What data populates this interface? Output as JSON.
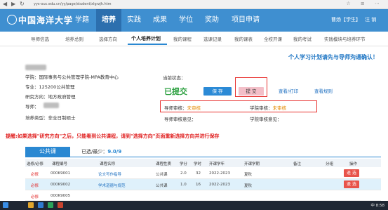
{
  "browser": {
    "url": "yys-ouc.edu.cn/yy/page/student/xlgrzjh.htm",
    "back": "◀",
    "forward": "▶",
    "refresh": "↻",
    "right_icons": "☆ ≡ ⋯"
  },
  "header": {
    "school_name": "中国海洋大学",
    "nav": [
      "学籍",
      "培养",
      "实践",
      "成果",
      "学位",
      "奖助",
      "项目申请"
    ],
    "user_name": "曹炀【学生】",
    "logout": "注 销"
  },
  "subnav": [
    "导师信选",
    "培养总则",
    "选择方向",
    "个人培养计划",
    "我的课程",
    "选课记录",
    "我的课表",
    "全校开课",
    "我的考试",
    "实践模块与培养环节"
  ],
  "panel": {
    "notice": "个人学习计划请先与导师沟通确认！",
    "info": [
      {
        "label": "学院：",
        "value": "国际事务与公共管理学院-MPA教育中心"
      },
      {
        "label": "专业：",
        "value": "125200公共管理"
      },
      {
        "label": "研究方向：",
        "value": "地方政府管理"
      },
      {
        "label": "导师：",
        "value": ""
      },
      {
        "label": "培养类型：",
        "value": "非全日制硕士"
      }
    ],
    "status_label": "当前状态：",
    "status_value": "已提交",
    "save": "保 存",
    "submit": "提 交",
    "view_print": "查看/打印",
    "view_rules": "查看规则",
    "advisor_review_label": "导师审核：",
    "advisor_review_value": "未审核",
    "college_review_label": "学院审核：",
    "college_review_value": "未审核",
    "advisor_opinion_label": "导师审核意见：",
    "college_opinion_label": "学院审核意见：",
    "warning": "提醒:如果选择\"研究方向\"之后，只能看到公共课程，请到\"选择方向\"页面重新选择方向并进行保存"
  },
  "table": {
    "tab": "公共课",
    "credits_label": "已选/最少：",
    "credits_value": "9.0/9",
    "headers": [
      "选修/必修",
      "课程编号",
      "课程名称",
      "课程性质",
      "学分",
      "学时",
      "开课学年",
      "开课学期",
      "备注",
      "分组",
      "操作"
    ],
    "rows": [
      {
        "req": "必修",
        "code": "000K9001",
        "name": "论文写作指导",
        "type": "公共课",
        "credit": "2.0",
        "hours": "32",
        "year": "2022-2023",
        "term": "夏秋",
        "note": "",
        "group": "",
        "action": "退 选"
      },
      {
        "req": "必修",
        "code": "000K9002",
        "name": "学术道德与规范",
        "type": "公共课",
        "credit": "1.0",
        "hours": "16",
        "year": "2022-2023",
        "term": "夏秋",
        "note": "",
        "group": "",
        "action": "退 选"
      },
      {
        "req": "必修",
        "code": "000K9005",
        "name": "",
        "type": "",
        "credit": "",
        "hours": "",
        "year": "",
        "term": "",
        "note": "",
        "group": "",
        "action": ""
      }
    ]
  },
  "taskbar": {
    "time": "8:58",
    "lang": "中"
  }
}
